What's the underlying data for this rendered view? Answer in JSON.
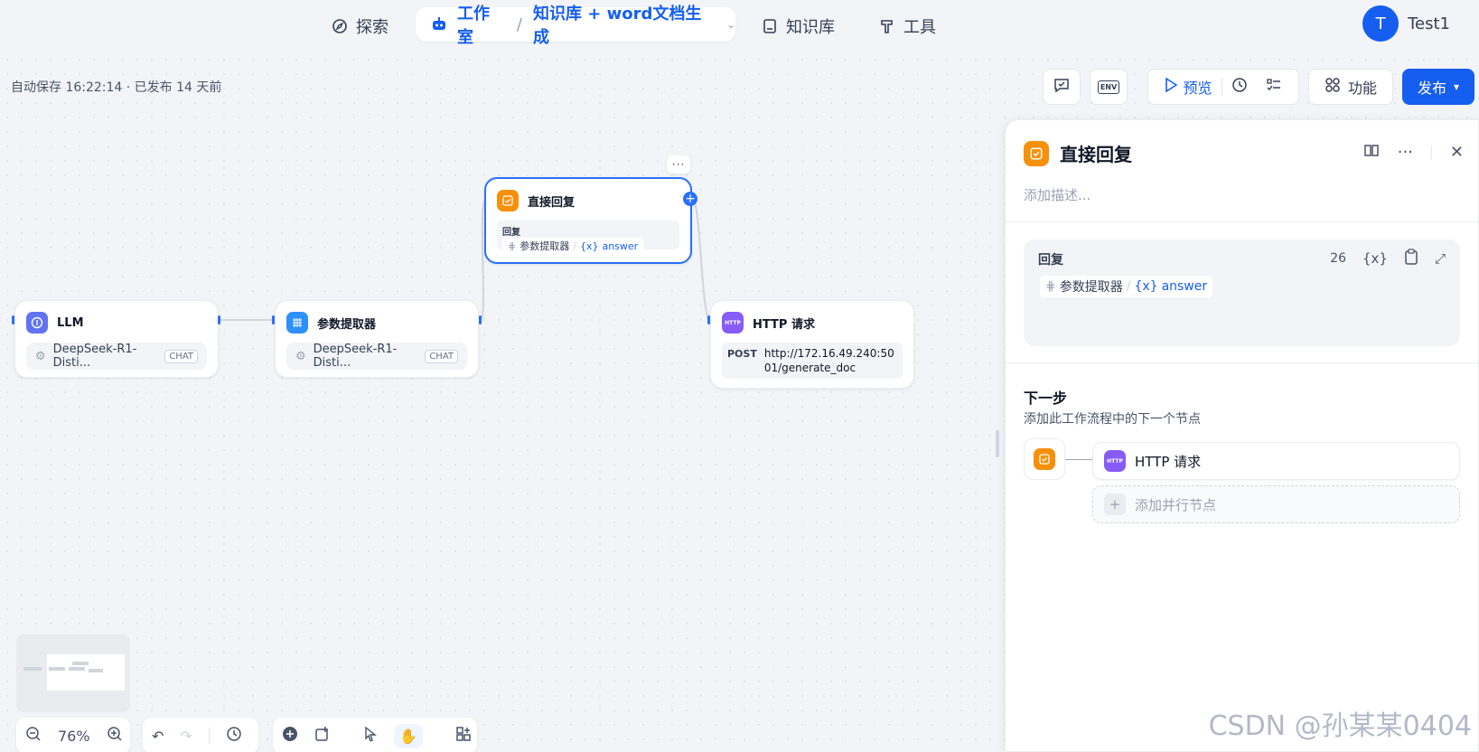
{
  "nav": {
    "explore": "探索",
    "studio": "工作室",
    "app_name": "知识库 + word文档生成",
    "knowledge": "知识库",
    "tools": "工具",
    "user_initial": "T",
    "user_name": "Test1"
  },
  "status": {
    "autosave": "自动保存 16:22:14 · 已发布 14 天前"
  },
  "toolbar": {
    "env_label": "ENV",
    "preview": "预览",
    "features": "功能",
    "publish": "发布"
  },
  "nodes": {
    "llm": {
      "title": "LLM",
      "model": "DeepSeek-R1-Disti...",
      "tag": "CHAT"
    },
    "param": {
      "title": "参数提取器",
      "model": "DeepSeek-R1-Disti...",
      "tag": "CHAT"
    },
    "reply": {
      "title": "直接回复",
      "box_label": "回复",
      "var_node": "参数提取器",
      "var_sep": "/",
      "var_name": "answer",
      "more": "···"
    },
    "http": {
      "title": "HTTP 请求",
      "icon_text": "HTTP",
      "method": "POST",
      "url": "http://172.16.49.240:5001/generate_doc"
    }
  },
  "panel": {
    "title": "直接回复",
    "desc_placeholder": "添加描述...",
    "reply_label": "回复",
    "char_count": "26",
    "var_node": "参数提取器",
    "var_sep": "/",
    "var_name": "answer",
    "next_title": "下一步",
    "next_sub": "添加此工作流程中的下一个节点",
    "next_node": "HTTP 请求",
    "next_node_icon": "HTTP",
    "add_parallel": "添加并行节点"
  },
  "controls": {
    "zoom": "76%"
  },
  "watermark": "CSDN @孙某某0404",
  "colors": {
    "accent": "#155eef",
    "reply_icon": "#f79009",
    "llm_icon": "#6172f3",
    "param_icon": "#2e90fa",
    "http_icon": "#875bf7"
  }
}
